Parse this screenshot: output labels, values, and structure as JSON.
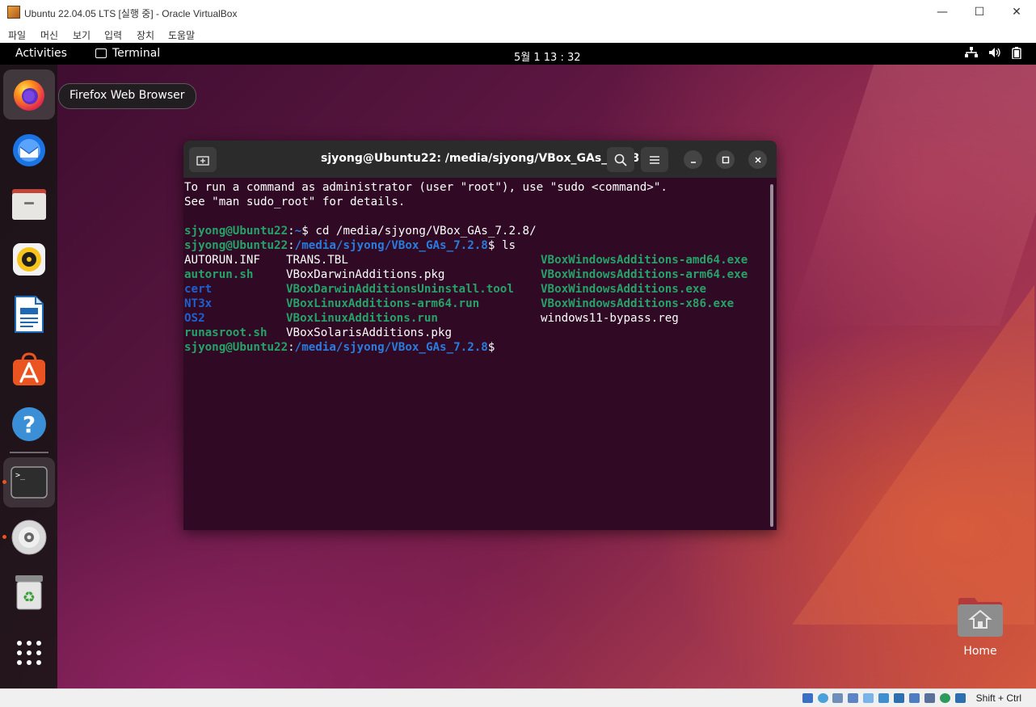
{
  "host": {
    "window_title": "Ubuntu 22.04.05 LTS [실행 중] - Oracle VirtualBox",
    "controls": {
      "minimize": "—",
      "maximize": "☐",
      "close": "✕"
    },
    "menu": [
      "파일",
      "머신",
      "보기",
      "입력",
      "장치",
      "도움말"
    ],
    "host_key": "Shift + Ctrl"
  },
  "topbar": {
    "activities": "Activities",
    "app_name": "Terminal",
    "clock": "5월 1  13 : 32"
  },
  "dock": {
    "tooltip": "Firefox Web Browser",
    "items": [
      "firefox",
      "thunderbird",
      "files",
      "rhythmbox",
      "libreoffice-writer",
      "app-center",
      "help",
      "terminal",
      "disc",
      "trash",
      "show-apps"
    ]
  },
  "terminal": {
    "title": "sjyong@Ubuntu22: /media/sjyong/VBox_GAs_7.2.8",
    "motd1": "To run a command as administrator (user \"root\"), use \"sudo <command>\".",
    "motd2": "See \"man sudo_root\" for details.",
    "prompt_user": "sjyong@Ubuntu22",
    "prompt_colon": ":",
    "home_path": "~",
    "dollar": "$ ",
    "cmd1": "cd /media/sjyong/VBox_GAs_7.2.8/",
    "media_path": "/media/sjyong/VBox_GAs_7.2.8",
    "cmd2": "ls",
    "files": [
      [
        "AUTORUN.INF",
        "TRANS.TBL",
        "VBoxWindowsAdditions-amd64.exe"
      ],
      [
        "autorun.sh",
        "VBoxDarwinAdditions.pkg",
        "VBoxWindowsAdditions-arm64.exe"
      ],
      [
        "cert",
        "VBoxDarwinAdditionsUninstall.tool",
        "VBoxWindowsAdditions.exe"
      ],
      [
        "NT3x",
        "VBoxLinuxAdditions-arm64.run",
        "VBoxWindowsAdditions-x86.exe"
      ],
      [
        "OS2",
        "VBoxLinuxAdditions.run",
        "windows11-bypass.reg"
      ],
      [
        "runasroot.sh",
        "VBoxSolarisAdditions.pkg",
        ""
      ]
    ]
  },
  "desktop": {
    "home_label": "Home"
  }
}
